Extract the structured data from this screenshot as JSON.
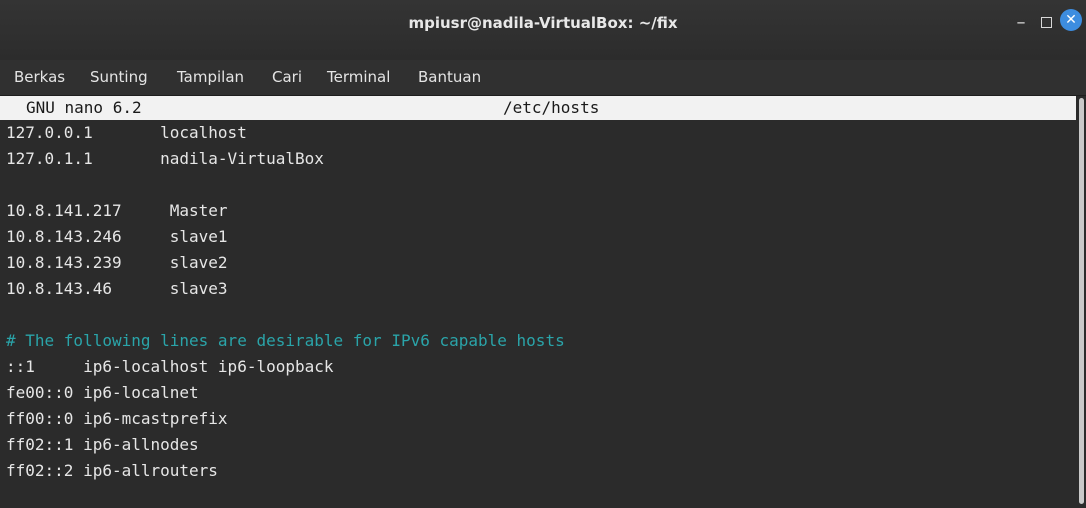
{
  "window": {
    "title": "mpiusr@nadila-VirtualBox: ~/fix",
    "minimize_glyph": "–",
    "close_glyph": "✕"
  },
  "menu": [
    "Berkas",
    "Sunting",
    "Tampilan",
    "Cari",
    "Terminal",
    "Bantuan"
  ],
  "nano": {
    "version": "GNU nano 6.2",
    "filename": "/etc/hosts"
  },
  "lines": [
    "127.0.0.1       localhost",
    "127.0.1.1       nadila-VirtualBox",
    "",
    "10.8.141.217     Master",
    "10.8.143.246     slave1",
    "10.8.143.239     slave2",
    "10.8.143.46      slave3",
    "",
    "# The following lines are desirable for IPv6 capable hosts",
    "::1     ip6-localhost ip6-loopback",
    "fe00::0 ip6-localnet",
    "ff00::0 ip6-mcastprefix",
    "ff02::1 ip6-allnodes",
    "ff02::2 ip6-allrouters"
  ],
  "colors": {
    "comment": "#2aa4a9",
    "close_button": "#3d8de0"
  }
}
